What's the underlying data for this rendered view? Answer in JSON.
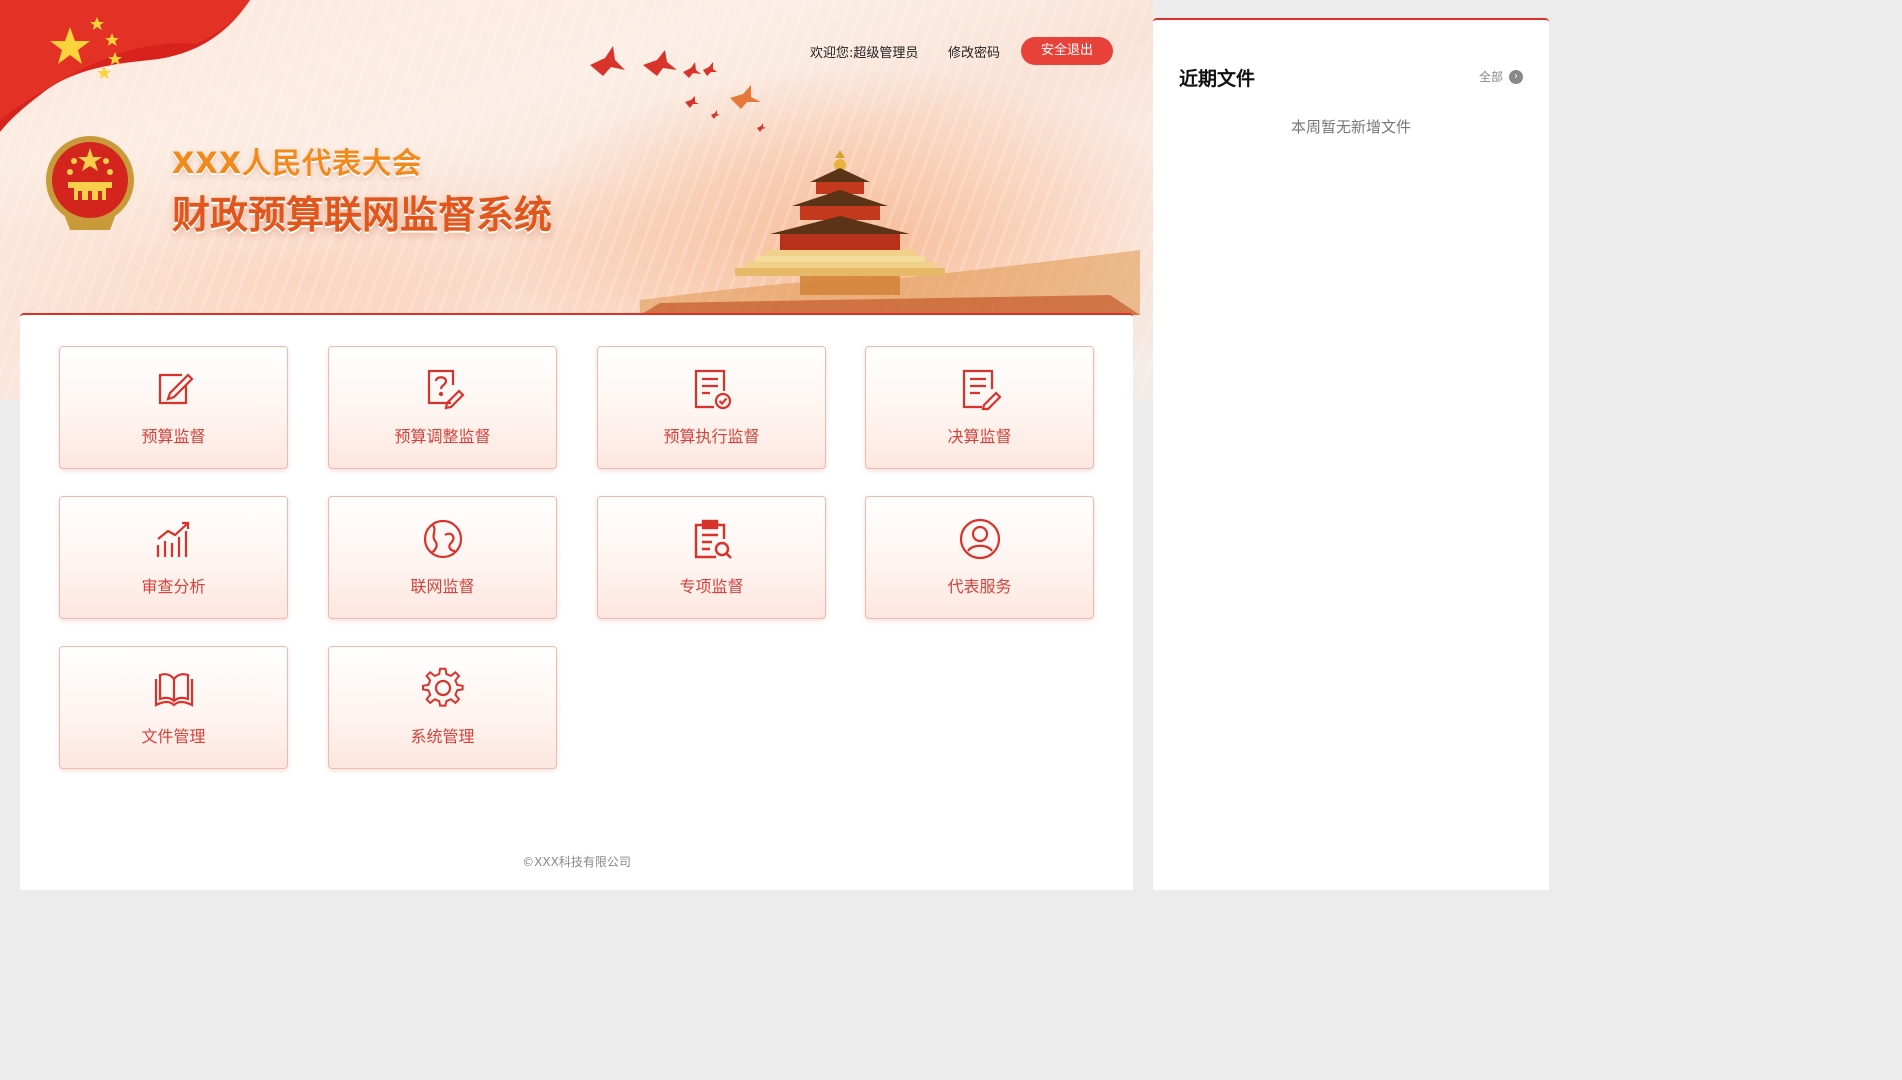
{
  "header": {
    "title_line1": "XXX人民代表大会",
    "title_line2": "财政预算联网监督系统",
    "welcome_prefix": "欢迎您:",
    "username": "超级管理员",
    "change_password": "修改密码",
    "logout": "安全退出"
  },
  "tiles": [
    {
      "label": "预算监督",
      "icon": "edit-icon"
    },
    {
      "label": "预算调整监督",
      "icon": "question-doc-icon"
    },
    {
      "label": "预算执行监督",
      "icon": "doc-check-icon"
    },
    {
      "label": "决算监督",
      "icon": "doc-pen-icon"
    },
    {
      "label": "审查分析",
      "icon": "bar-chart-icon"
    },
    {
      "label": "联网监督",
      "icon": "globe-icon"
    },
    {
      "label": "专项监督",
      "icon": "clipboard-search-icon"
    },
    {
      "label": "代表服务",
      "icon": "user-icon"
    },
    {
      "label": "文件管理",
      "icon": "book-icon"
    },
    {
      "label": "系统管理",
      "icon": "gear-icon"
    }
  ],
  "footer": "©XXX科技有限公司",
  "recent_files": {
    "title": "近期文件",
    "all_label": "全部",
    "empty_text": "本周暂无新增文件"
  },
  "colors": {
    "accent": "#d9322a",
    "button": "#e8413a",
    "tile_text": "#d6423a"
  }
}
